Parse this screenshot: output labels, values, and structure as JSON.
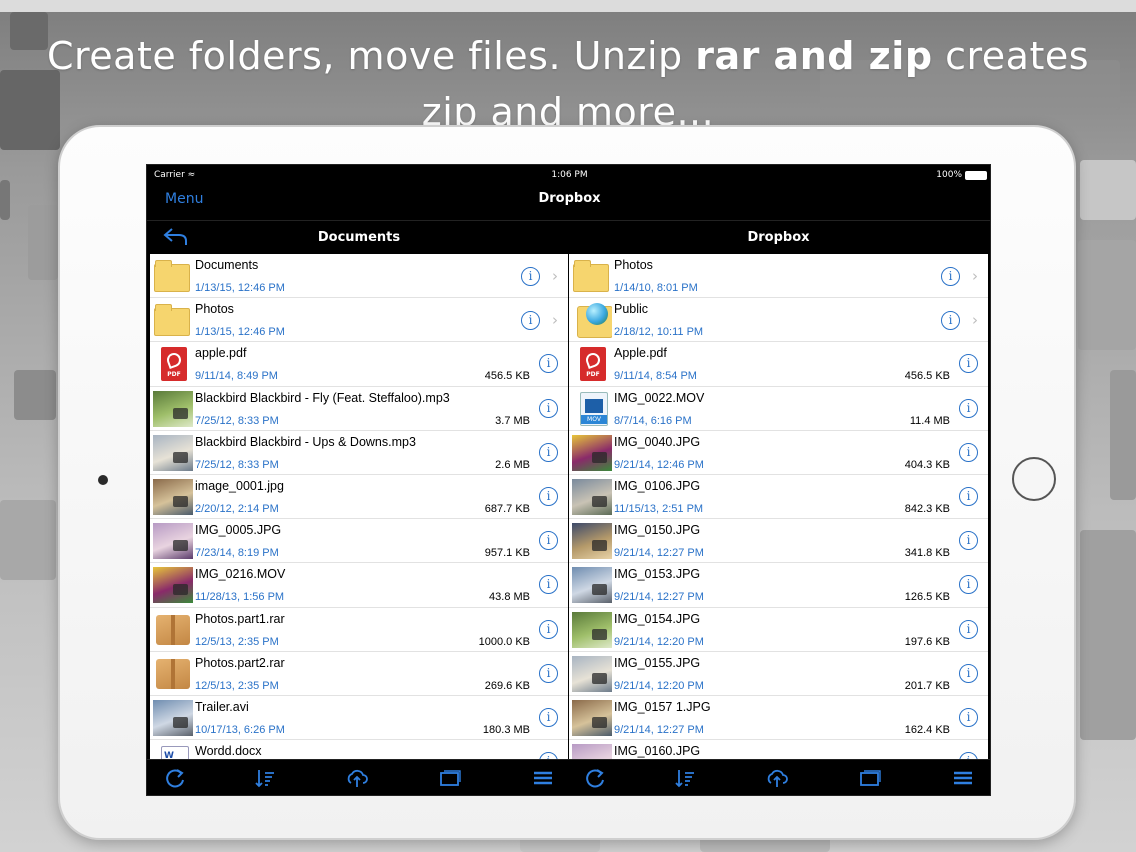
{
  "headline": {
    "part1": "Create folders, move files. Unzip ",
    "bold": "rar and zip",
    "part2": " creates zip and more..."
  },
  "status_bar": {
    "carrier": "Carrier",
    "time": "1:06 PM",
    "battery": "100%"
  },
  "nav": {
    "menu_label": "Menu",
    "title": "Dropbox"
  },
  "left_pane": {
    "title": "Documents",
    "items": [
      {
        "name": "Documents",
        "date": "1/13/15, 12:46 PM",
        "size": "",
        "icon": "folder-icon"
      },
      {
        "name": "Photos",
        "date": "1/13/15, 12:46 PM",
        "size": "",
        "icon": "folder-icon"
      },
      {
        "name": "apple.pdf",
        "date": "9/11/14, 8:49 PM",
        "size": "456.5 KB",
        "icon": "pdf-icon"
      },
      {
        "name": "Blackbird Blackbird - Fly (Feat. Steffaloo).mp3",
        "date": "7/25/12, 8:33 PM",
        "size": "3.7 MB",
        "icon": "album-art-thumbnail"
      },
      {
        "name": "Blackbird Blackbird - Ups & Downs.mp3",
        "date": "7/25/12, 8:33 PM",
        "size": "2.6 MB",
        "icon": "album-art-thumbnail"
      },
      {
        "name": "image_0001.jpg",
        "date": "2/20/12, 2:14 PM",
        "size": "687.7 KB",
        "icon": "photo-thumbnail"
      },
      {
        "name": "IMG_0005.JPG",
        "date": "7/23/14, 8:19 PM",
        "size": "957.1 KB",
        "icon": "photo-thumbnail"
      },
      {
        "name": "IMG_0216.MOV",
        "date": "11/28/13, 1:56 PM",
        "size": "43.8 MB",
        "icon": "video-thumbnail"
      },
      {
        "name": "Photos.part1.rar",
        "date": "12/5/13, 2:35 PM",
        "size": "1000.0 KB",
        "icon": "archive-box-icon"
      },
      {
        "name": "Photos.part2.rar",
        "date": "12/5/13, 2:35 PM",
        "size": "269.6 KB",
        "icon": "archive-box-icon"
      },
      {
        "name": "Trailer.avi",
        "date": "10/17/13, 6:26 PM",
        "size": "180.3 MB",
        "icon": "video-thumbnail"
      },
      {
        "name": "Wordd.docx",
        "date": "",
        "size": "",
        "icon": "word-doc-icon"
      }
    ]
  },
  "right_pane": {
    "title": "Dropbox",
    "items": [
      {
        "name": "Photos",
        "date": "1/14/10, 8:01 PM",
        "size": "",
        "icon": "folder-icon"
      },
      {
        "name": "Public",
        "date": "2/18/12, 10:11 PM",
        "size": "",
        "icon": "public-folder-icon"
      },
      {
        "name": "Apple.pdf",
        "date": "9/11/14, 8:54 PM",
        "size": "456.5 KB",
        "icon": "pdf-icon"
      },
      {
        "name": "IMG_0022.MOV",
        "date": "8/7/14, 6:16 PM",
        "size": "11.4 MB",
        "icon": "mov-file-icon"
      },
      {
        "name": "IMG_0040.JPG",
        "date": "9/21/14, 12:46 PM",
        "size": "404.3 KB",
        "icon": "photo-thumbnail"
      },
      {
        "name": "IMG_0106.JPG",
        "date": "11/15/13, 2:51 PM",
        "size": "842.3 KB",
        "icon": "photo-thumbnail"
      },
      {
        "name": "IMG_0150.JPG",
        "date": "9/21/14, 12:27 PM",
        "size": "341.8 KB",
        "icon": "photo-thumbnail"
      },
      {
        "name": "IMG_0153.JPG",
        "date": "9/21/14, 12:27 PM",
        "size": "126.5 KB",
        "icon": "photo-thumbnail"
      },
      {
        "name": "IMG_0154.JPG",
        "date": "9/21/14, 12:20 PM",
        "size": "197.6 KB",
        "icon": "photo-thumbnail"
      },
      {
        "name": "IMG_0155.JPG",
        "date": "9/21/14, 12:20 PM",
        "size": "201.7 KB",
        "icon": "photo-thumbnail"
      },
      {
        "name": "IMG_0157 1.JPG",
        "date": "9/21/14, 12:27 PM",
        "size": "162.4 KB",
        "icon": "photo-thumbnail"
      },
      {
        "name": "IMG_0160.JPG",
        "date": "",
        "size": "",
        "icon": "photo-thumbnail"
      }
    ]
  },
  "toolbar": {
    "buttons": [
      "refresh-icon",
      "sort-icon",
      "upload-icon",
      "windows-icon",
      "list-menu-icon"
    ]
  },
  "colors": {
    "accent_blue": "#2a72c8",
    "nav_blue": "#2f7fe0",
    "folder_yellow": "#f6d56e",
    "pdf_red": "#d62b2b"
  }
}
